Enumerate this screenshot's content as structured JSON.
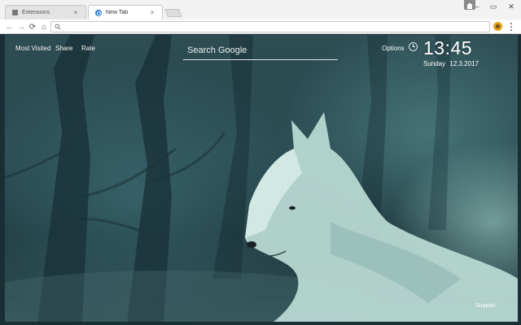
{
  "browser": {
    "tabs": [
      {
        "title": "Extensions",
        "icon": "puzzle-icon",
        "active": false
      },
      {
        "title": "New Tab",
        "icon": "newtab-icon",
        "active": true
      }
    ],
    "close_glyph": "×",
    "window_controls": {
      "minimize": "–",
      "maximize": "▭",
      "close": "✕"
    },
    "toolbar": {
      "back": "←",
      "forward": "→",
      "reload": "⟳",
      "home": "⌂",
      "search_icon": "🔍",
      "address_value": ""
    }
  },
  "newtab": {
    "links": {
      "most_visited": "Most Visited",
      "share": "Share",
      "rate": "Rate"
    },
    "search": {
      "placeholder": "Search Google"
    },
    "options": "Options",
    "clock": {
      "time": "13:45",
      "weekday": "Sunday",
      "date": "12.3.2017"
    },
    "support": "Support",
    "background": {
      "subject": "white wolf in misty forest",
      "accent_color": "#2d4d53"
    }
  }
}
